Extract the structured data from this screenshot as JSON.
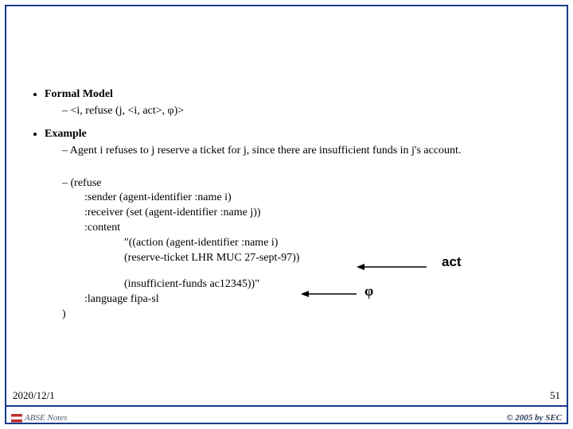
{
  "sections": {
    "formal_model": {
      "title": "Formal Model",
      "item": "<i, refuse (j, <i, act>, φ)>"
    },
    "example": {
      "title": "Example",
      "desc": "Agent i refuses to j reserve a ticket for j, since there are insufficient funds in j's account.",
      "code": {
        "l0": "(refuse",
        "l1": ":sender (agent-identifier :name i)",
        "l2": ":receiver (set (agent-identifier :name j))",
        "l3": ":content",
        "l4": "\"((action (agent-identifier :name i)",
        "l5": "(reserve-ticket LHR MUC 27-sept-97))",
        "l6": "(insufficient-funds ac12345))\"",
        "l7": ":language fipa-sl",
        "l8": ")"
      }
    }
  },
  "annotations": {
    "act": "act",
    "phi": "φ"
  },
  "footer": {
    "date": "2020/12/1",
    "page": "51",
    "notes": "ABSE Notes",
    "copyright": "© 2005 by SEC"
  }
}
